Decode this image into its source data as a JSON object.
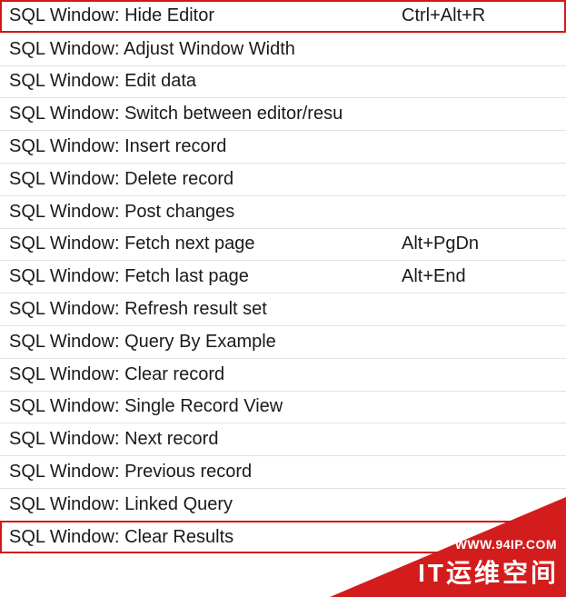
{
  "rows": [
    {
      "command": "SQL Window: Hide Editor",
      "shortcut": "Ctrl+Alt+R",
      "highlight": true
    },
    {
      "command": "SQL Window: Adjust Window Width",
      "shortcut": "",
      "highlight": false
    },
    {
      "command": "SQL Window: Edit data",
      "shortcut": "",
      "highlight": false
    },
    {
      "command": "SQL Window: Switch between editor/resu",
      "shortcut": "",
      "highlight": false
    },
    {
      "command": "SQL Window: Insert record",
      "shortcut": "",
      "highlight": false
    },
    {
      "command": "SQL Window: Delete record",
      "shortcut": "",
      "highlight": false
    },
    {
      "command": "SQL Window: Post changes",
      "shortcut": "",
      "highlight": false
    },
    {
      "command": "SQL Window: Fetch next page",
      "shortcut": "Alt+PgDn",
      "highlight": false
    },
    {
      "command": "SQL Window: Fetch last page",
      "shortcut": "Alt+End",
      "highlight": false
    },
    {
      "command": "SQL Window: Refresh result set",
      "shortcut": "",
      "highlight": false
    },
    {
      "command": "SQL Window: Query By Example",
      "shortcut": "",
      "highlight": false
    },
    {
      "command": "SQL Window: Clear record",
      "shortcut": "",
      "highlight": false
    },
    {
      "command": "SQL Window: Single Record View",
      "shortcut": "",
      "highlight": false
    },
    {
      "command": "SQL Window: Next record",
      "shortcut": "",
      "highlight": false
    },
    {
      "command": "SQL Window: Previous record",
      "shortcut": "",
      "highlight": false
    },
    {
      "command": "SQL Window: Linked Query",
      "shortcut": "",
      "highlight": false
    },
    {
      "command": "SQL Window: Clear Results",
      "shortcut": "",
      "highlight": true
    }
  ],
  "watermark": {
    "url": "WWW.94IP.COM",
    "main": "IT运维空间"
  }
}
